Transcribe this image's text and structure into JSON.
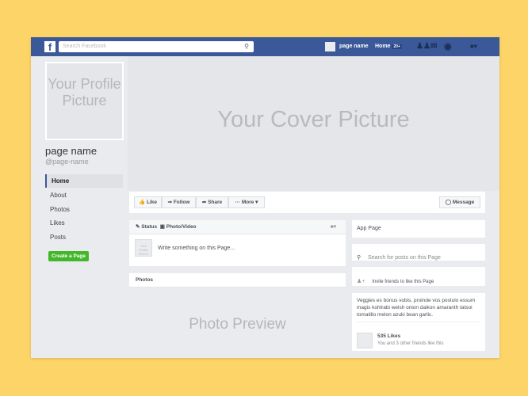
{
  "topbar": {
    "logo": "f",
    "search_placeholder": "Search Facebook",
    "page_name": "page name",
    "home": "Home",
    "home_badge": "20+"
  },
  "cover": {
    "text": "Your Cover Picture"
  },
  "profile": {
    "picture_text": "Your Profile Picture",
    "name": "page name",
    "handle": "@page-name"
  },
  "nav": [
    {
      "label": "Home",
      "active": true
    },
    {
      "label": "About"
    },
    {
      "label": "Photos"
    },
    {
      "label": "Likes"
    },
    {
      "label": "Posts"
    }
  ],
  "create_page": "Create a Page",
  "actions": {
    "like": "Like",
    "follow": "Follow",
    "share": "Share",
    "more": "More",
    "message": "Message"
  },
  "composer": {
    "status": "Status",
    "photo_video": "Photo/Video",
    "placeholder": "Write something on this Page...",
    "thumb": "Your Profile Picture"
  },
  "photos": {
    "title": "Photos",
    "preview": "Photo Preview"
  },
  "sidebar": {
    "app_page": "App Page",
    "search_placeholder": "Search for posts on this Page",
    "invite": "Invite friends to like this Page",
    "about": "Veggies es bonus vobis, proinde vos postulo essum magis kohlrabi welsh onion daikon amaranth tatsoi tomatillo melon azuki bean garlic.",
    "likes": "535 Likes",
    "likes_sub": "You and 3 other friends like this"
  }
}
